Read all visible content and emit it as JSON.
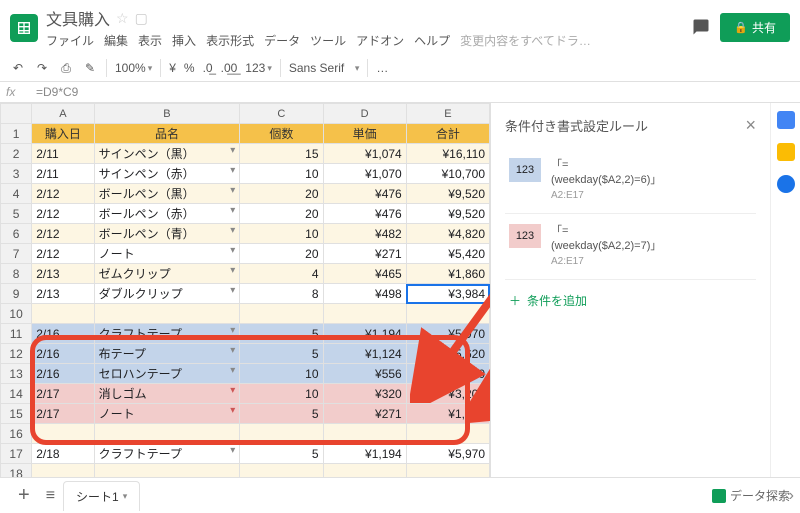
{
  "doc": {
    "title": "文具購入"
  },
  "menus": [
    "ファイル",
    "編集",
    "表示",
    "挿入",
    "表示形式",
    "データ",
    "ツール",
    "アドオン",
    "ヘルプ"
  ],
  "menu_hint": "変更内容をすべてドラ…",
  "share": "共有",
  "toolbar": {
    "zoom": "100%",
    "currency": "¥",
    "percent": "%",
    "dec0": ".0̲",
    "dec00": ".0̲0̲",
    "numfmt": "123",
    "font": "Sans Serif",
    "more": "…"
  },
  "formula": "=D9*C9",
  "cols": [
    "",
    "A",
    "B",
    "C",
    "D",
    "E"
  ],
  "headers": {
    "A": "購入日",
    "B": "品名",
    "C": "個数",
    "D": "単価",
    "E": "合計"
  },
  "rows": [
    {
      "r": "1"
    },
    {
      "r": "2",
      "a": "2/11",
      "b": "サインペン（黒）",
      "c": "15",
      "d": "¥1,074",
      "e": "¥16,110"
    },
    {
      "r": "3",
      "a": "2/11",
      "b": "サインペン（赤）",
      "c": "10",
      "d": "¥1,070",
      "e": "¥10,700"
    },
    {
      "r": "4",
      "a": "2/12",
      "b": "ボールペン（黒）",
      "c": "20",
      "d": "¥476",
      "e": "¥9,520"
    },
    {
      "r": "5",
      "a": "2/12",
      "b": "ボールペン（赤）",
      "c": "20",
      "d": "¥476",
      "e": "¥9,520"
    },
    {
      "r": "6",
      "a": "2/12",
      "b": "ボールペン（青）",
      "c": "10",
      "d": "¥482",
      "e": "¥4,820"
    },
    {
      "r": "7",
      "a": "2/12",
      "b": "ノート",
      "c": "20",
      "d": "¥271",
      "e": "¥5,420"
    },
    {
      "r": "8",
      "a": "2/13",
      "b": "ゼムクリップ",
      "c": "4",
      "d": "¥465",
      "e": "¥1,860"
    },
    {
      "r": "9",
      "a": "2/13",
      "b": "ダブルクリップ",
      "c": "8",
      "d": "¥498",
      "e": "¥3,984"
    },
    {
      "r": "10",
      "a": "",
      "b": "",
      "c": "",
      "d": "",
      "e": ""
    },
    {
      "r": "11",
      "a": "2/16",
      "b": "クラフトテープ",
      "c": "5",
      "d": "¥1,194",
      "e": "¥5,970"
    },
    {
      "r": "12",
      "a": "2/16",
      "b": "布テープ",
      "c": "5",
      "d": "¥1,124",
      "e": "¥5,620"
    },
    {
      "r": "13",
      "a": "2/16",
      "b": "セロハンテープ",
      "c": "10",
      "d": "¥556",
      "e": "¥5,560"
    },
    {
      "r": "14",
      "a": "2/17",
      "b": "消しゴム",
      "c": "10",
      "d": "¥320",
      "e": "¥3,200"
    },
    {
      "r": "15",
      "a": "2/17",
      "b": "ノート",
      "c": "5",
      "d": "¥271",
      "e": "¥1,355"
    },
    {
      "r": "16",
      "a": "",
      "b": "",
      "c": "",
      "d": "",
      "e": ""
    },
    {
      "r": "17",
      "a": "2/18",
      "b": "クラフトテープ",
      "c": "5",
      "d": "¥1,194",
      "e": "¥5,970"
    },
    {
      "r": "18"
    },
    {
      "r": "19"
    }
  ],
  "panel": {
    "title": "条件付き書式設定ルール",
    "rules": [
      {
        "preview": "123",
        "label_prefix": "「=",
        "formula": "(weekday($A2,2)=6)」",
        "range": "A2:E17"
      },
      {
        "preview": "123",
        "label_prefix": "「=",
        "formula": "(weekday($A2,2)=7)」",
        "range": "A2:E17"
      }
    ],
    "add": "条件を追加"
  },
  "sheet_tab": "シート1",
  "explore": "データ探索"
}
